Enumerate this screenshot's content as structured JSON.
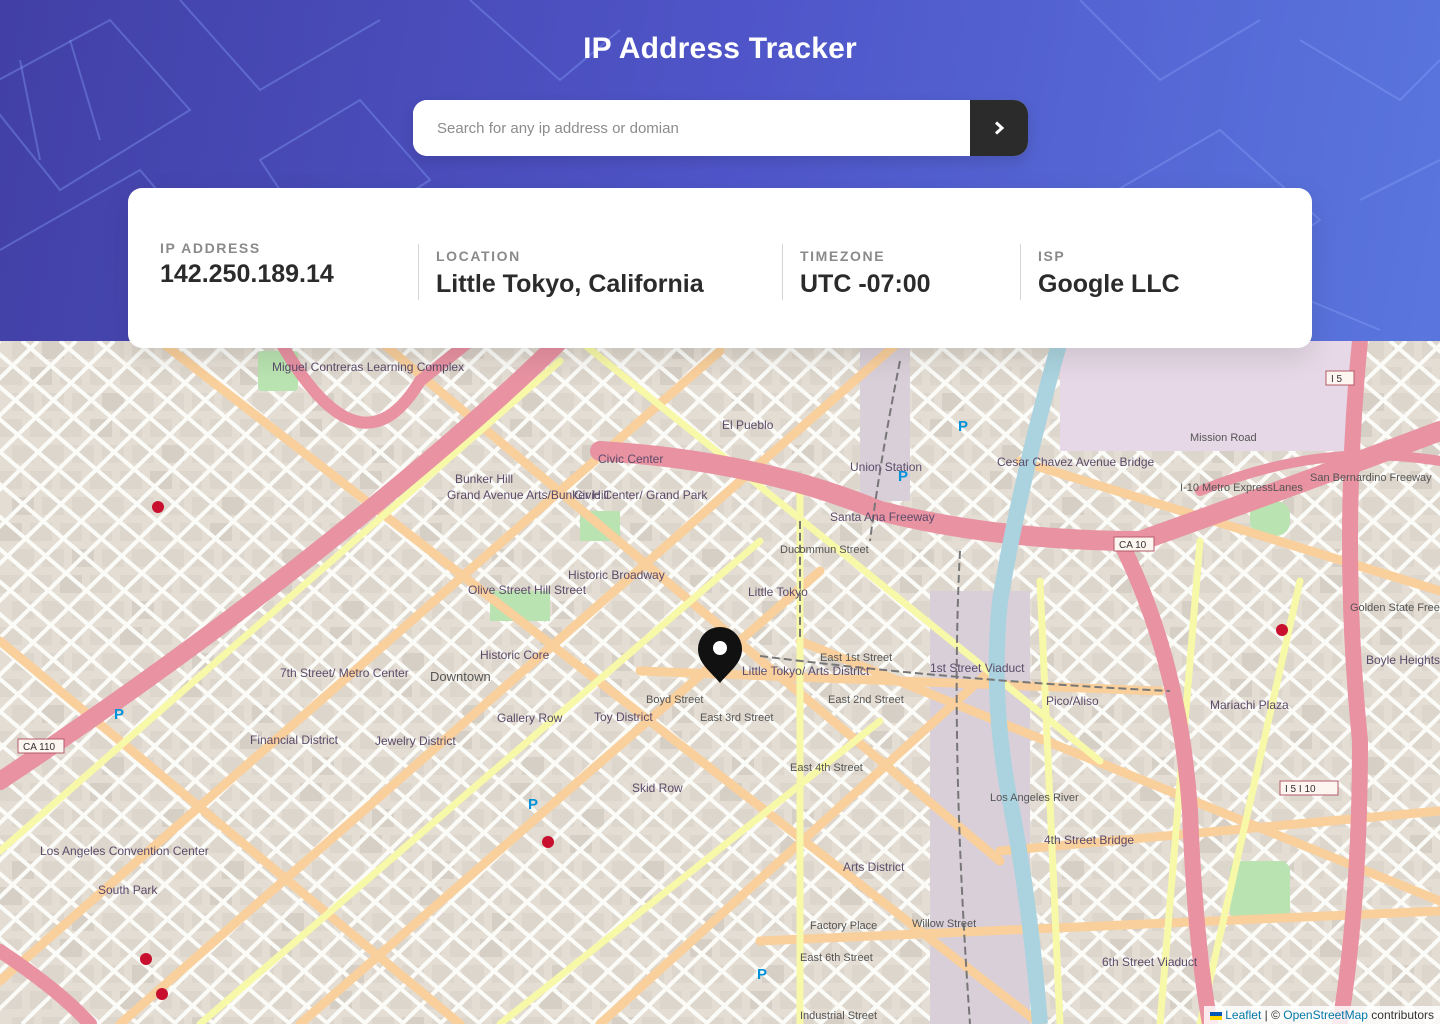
{
  "header": {
    "title": "IP Address Tracker"
  },
  "search": {
    "placeholder": "Search for any ip address or domian",
    "value": "",
    "button_icon": "chevron-right-icon"
  },
  "info": {
    "ip_label": "IP Address",
    "ip_value": "142.250.189.14",
    "location_label": "Location",
    "location_value": "Little Tokyo, California",
    "timezone_label": "Timezone",
    "timezone_value": "UTC -07:00",
    "isp_label": "ISP",
    "isp_value": "Google LLC"
  },
  "map": {
    "marker_icon": "location-pin-icon",
    "labels": [
      "Civic Center",
      "Bunker Hill",
      "Grand Avenue Arts/Bunker Hill",
      "Civic Center/ Grand Park",
      "Historic Broadway",
      "Olive Street Hill Street",
      "Historic Core",
      "Downtown",
      "7th Street/ Metro Center",
      "Financial District",
      "Jewelry District",
      "Gallery Row",
      "Toy District",
      "Little Tokyo",
      "Little Tokyo/ Arts District",
      "Skid Row",
      "Arts District",
      "Union Station",
      "El Pueblo",
      "Cesar Chavez Avenue Bridge",
      "Pico/Aliso",
      "Mariachi Plaza",
      "Boyle Heights",
      "4th Street Bridge",
      "6th Street Viaduct",
      "1st Street Viaduct",
      "Los Angeles Convention Center",
      "South Park",
      "Miguel Contreras Learning Complex",
      "Santa Ana Freeway",
      "Mission Road",
      "I-10 Metro ExpressLanes",
      "San Bernardino Freeway",
      "Golden State Freeway",
      "Los Angeles River",
      "East 1st Street",
      "East 3rd Street",
      "East 4th Street",
      "East 6th Street",
      "Ducommun Street",
      "Factory Place",
      "Willow Street",
      "Industrial Street",
      "Boyd Street",
      "East 2nd Street"
    ],
    "route_badges": [
      "CA 110",
      "CA 10",
      "I 5",
      "I 5 I 10"
    ]
  },
  "attribution": {
    "leaflet": "Leaflet",
    "sep": " | © ",
    "osm": "OpenStreetMap",
    "suffix": " contributors"
  }
}
